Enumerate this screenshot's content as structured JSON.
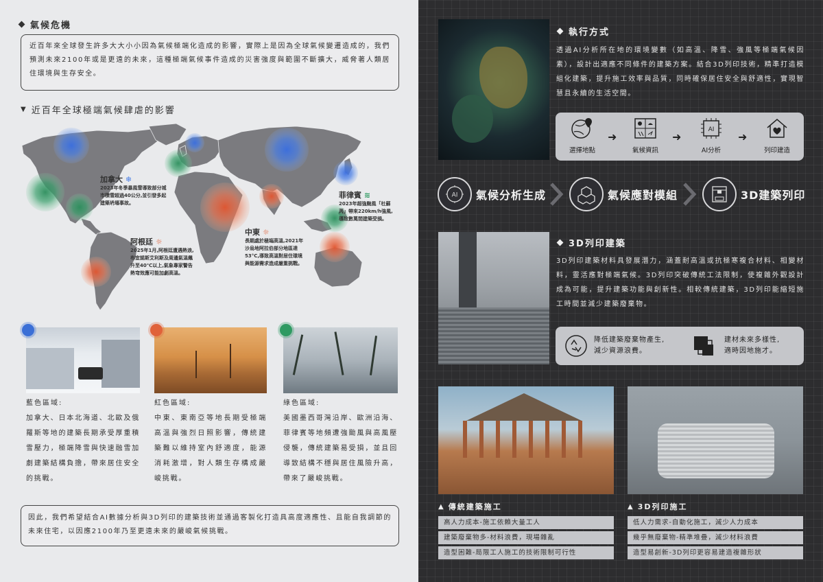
{
  "left": {
    "climate": {
      "title": "氣候危機",
      "text": "近百年來全球發生許多大大小小因為氣候極端化造成的影響，實際上是因為全球氣候變遷造成的，我們預測未來2100年或是更遠的未來，這種極端氣候事件造成的災害強度與範圍不斷擴大，威脅著人類居住環境與生存安全。"
    },
    "map": {
      "title": "近百年全球極端氣候肆虐的影響",
      "callouts": [
        {
          "title": "加拿大",
          "text": "2023年冬季暴風雪導致部分城市積雪超過40公分,並引發多起建築坍塌事故。"
        },
        {
          "title": "阿根廷",
          "text": "2025年1月,阿根廷遭遇熱浪,布宜諾斯艾利斯及周邊氣溫飆升至40℃以上,氣象專家警告熱穹效應可能加劇高溫。"
        },
        {
          "title": "中東",
          "text": "長期處於極端高溫,2021年沙烏地阿拉伯部分地區達53°C,導致高溫對居住環境與能源需求造成嚴重挑戰。"
        },
        {
          "title": "菲律賓",
          "text": "2023年超強颱風「杜蘇芮」帶來220km/h強風,導致數萬間建築受損。"
        }
      ]
    },
    "regions": [
      {
        "title": "藍色區域:",
        "text": "加拿大、日本北海道、北歐及俄羅斯等地的建築長期承受厚重積雪壓力，極端降雪與快速融雪加劇建築結構負擔，帶來居住安全的挑戰。",
        "color": "#3b6fd6"
      },
      {
        "title": "紅色區域:",
        "text": "中東、東南亞等地長期受極端高溫與強烈日照影響，傳統建築難以維持室內舒適度，能源消耗激增，對人類生存構成嚴峻挑戰。",
        "color": "#e0623a"
      },
      {
        "title": "綠色區域:",
        "text": "美國墨西哥灣沿岸、歐洲沿海、菲律賓等地頻遭強颱風與高風壓侵襲，傳統建築易受損，並且回導致結構不穩與居住風險升高，帶來了嚴峻挑戰。",
        "color": "#2f9a62"
      }
    ],
    "conclusion": "因此，我們希望結合AI數據分析與3D列印的建築技術並通過客製化打造具高度適應性、且能自我調節的未來住宅，以因應2100年乃至更遠未來的嚴峻氣候挑戰。"
  },
  "right": {
    "method": {
      "title": "執行方式",
      "text": "透過AI分析所在地的環境變數（如高溫、降雪、強風等極端氣候因素），設計出適應不同條件的建築方案。結合3D列印技術，精準打造模組化建築，提升施工效率與品質，同時確保居住安全與舒適性，實現智慧且永續的生活空間。"
    },
    "flow": [
      "選擇地點",
      "氣候資訊",
      "AI分析",
      "列印建造"
    ],
    "stages": [
      "氣候分析生成",
      "氣候應對模組",
      "3D建築列印"
    ],
    "print": {
      "title": "3D列印建築",
      "text": "3D列印建築材料具發展潛力，涵蓋耐高溫或抗極寒複合材料、相變材料，靈活應對極端氣候。3D列印突破傳統工法限制，使複雜外觀設計成為可能，提升建築功能與創新性。相較傳統建築，3D列印能縮短施工時間並減少建築廢棄物。"
    },
    "benefits": [
      {
        "text": "降低建築廢棄物產生,\n減少資源浪費。"
      },
      {
        "text": "建材未來多樣性,\n適時因地施才。"
      }
    ],
    "traditional": {
      "title": "傳統建築施工",
      "items": [
        "高人力成本-施工依賴大量工人",
        "建築廢棄物多-材料浪費，現場雜亂",
        "造型困難-局限工人施工的技術限制可行性"
      ]
    },
    "printed": {
      "title": "3D列印施工",
      "items": [
        "低人力需求-自動化施工，減少人力成本",
        "幾乎無廢棄物-精準堆疊，減少材料浪費",
        "造型易創新-3D列印更容易建造複雜形狀"
      ]
    }
  }
}
